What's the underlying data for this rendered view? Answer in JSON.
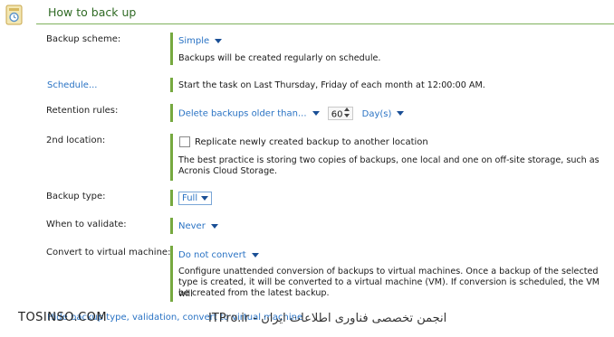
{
  "section": {
    "title": "How to back up"
  },
  "rows": {
    "backup_scheme": {
      "label": "Backup scheme:",
      "value": "Simple",
      "description": "Backups will be created regularly on schedule."
    },
    "schedule": {
      "link": "Schedule...",
      "description": "Start the task on Last Thursday, Friday of each month at 12:00:00 AM."
    },
    "retention": {
      "label": "Retention rules:",
      "rule": "Delete backups older than...",
      "number": "60",
      "unit": "Day(s)"
    },
    "second_location": {
      "label": "2nd location:",
      "checkbox_label": "Replicate newly created backup to another location",
      "description_line1": "The best practice is storing two copies of backups, one local and one on off-site storage, such as",
      "description_line2": "Acronis Cloud Storage."
    },
    "backup_type": {
      "label": "Backup type:",
      "value": "Full"
    },
    "validate": {
      "label": "When to validate:",
      "value": "Never"
    },
    "convert": {
      "label": "Convert to virtual machine:",
      "value": "Do not convert",
      "description_line1": "Configure unattended conversion of backups to virtual machines. Once a backup of the selected",
      "description_line2": "type is created, it will be converted to a virtual machine (VM). If conversion is scheduled, the VM will",
      "description_line3": "be created from the latest backup."
    }
  },
  "footer": {
    "link": "Hide backup type, validation, convert to virtual machine"
  },
  "watermark": {
    "left": "TOSINSO.COM",
    "right": "انجمن تخصصی فناوری اطلاعات ایران - ITPro.ir"
  },
  "colors": {
    "accent_green": "#76a940",
    "link_blue": "#2a73c4",
    "title_green": "#2f6a24"
  }
}
